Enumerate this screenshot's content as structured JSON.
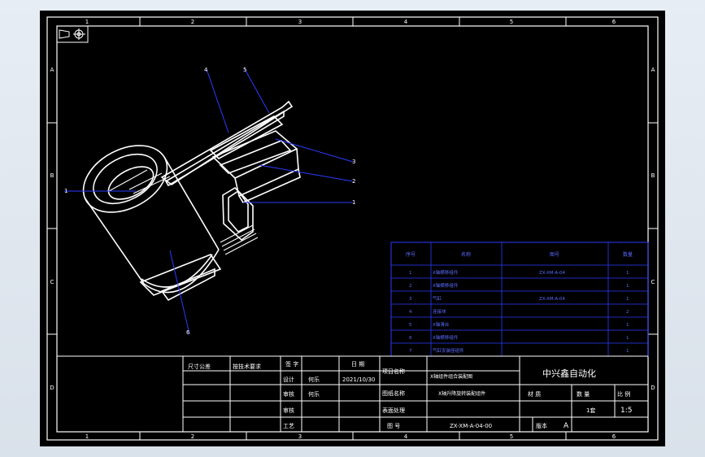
{
  "drawing": {
    "border_columns": [
      "1",
      "2",
      "3",
      "4",
      "5",
      "6"
    ],
    "border_rows": [
      "A",
      "B",
      "C",
      "D"
    ],
    "balloons": [
      "4",
      "5",
      "3",
      "2",
      "1",
      "1",
      "6"
    ],
    "colors": {
      "background": "#000000",
      "lines": "#ffffff",
      "leaders": "#2a3cff",
      "frame": "#ffffff"
    }
  },
  "bom": {
    "header": [
      "序号",
      "名称",
      "图号",
      "数量"
    ],
    "rows": [
      {
        "no": "1",
        "name": "X轴横移组件",
        "drawing": "ZX-XM-A-04",
        "qty": "1"
      },
      {
        "no": "2",
        "name": "X轴横移组件",
        "drawing": "",
        "qty": "1"
      },
      {
        "no": "3",
        "name": "气缸",
        "drawing": "ZX-XM-A-04",
        "qty": "1"
      },
      {
        "no": "4",
        "name": "连接块",
        "drawing": "",
        "qty": "2"
      },
      {
        "no": "5",
        "name": "X轴滑台",
        "drawing": "",
        "qty": "1"
      },
      {
        "no": "6",
        "name": "X轴横移组件",
        "drawing": "",
        "qty": "1"
      },
      {
        "no": "7",
        "name": "气缸安装座组件",
        "drawing": "",
        "qty": "1"
      }
    ]
  },
  "title_block": {
    "tolerance_label": "尺寸公差",
    "tolerance_value": "按技术要求",
    "sign_col1": "签 字",
    "date_col": "日 期",
    "design_label": "设计",
    "designer": "何乐",
    "date": "2021/10/30",
    "check_label": "审核",
    "checker": "何乐",
    "approve_label": "审核",
    "process_label": "工艺",
    "project_label": "项目名称",
    "project_value": "X轴组件组合装配图",
    "drawing_name_label": "图纸名称",
    "drawing_name_value": "X轴升降旋转装配组件",
    "surface_label": "表面处理",
    "material_label": "材 质",
    "qty_label": "数 量",
    "scale_label": "比 例",
    "qty_value": "1套",
    "scale_value": "1:5",
    "drawing_no_label": "图 号",
    "drawing_no": "ZX-XM-A-04-00",
    "version_label": "版本",
    "version": "A",
    "company": "中兴鑫自动化"
  }
}
